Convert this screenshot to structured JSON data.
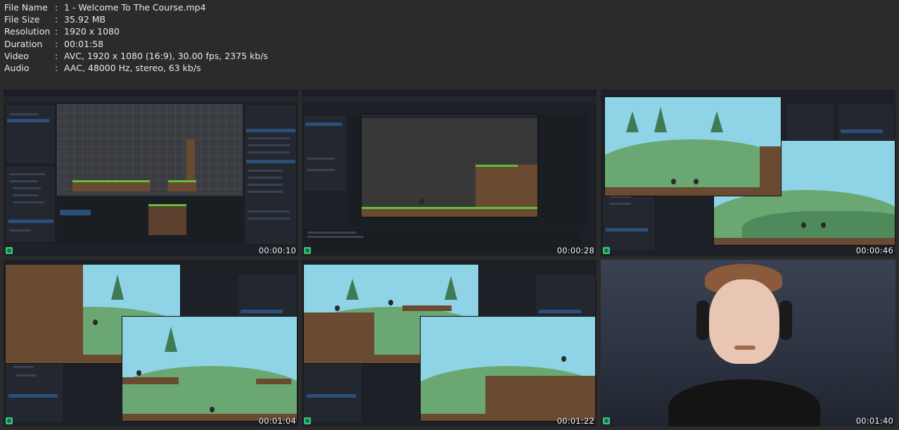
{
  "info": [
    {
      "key": "File Name",
      "value": "1 - Welcome To The Course.mp4"
    },
    {
      "key": "File Size",
      "value": "35.92 MB"
    },
    {
      "key": "Resolution",
      "value": "1920 x 1080"
    },
    {
      "key": "Duration",
      "value": "00:01:58"
    },
    {
      "key": "Video",
      "value": "AVC, 1920 x 1080 (16:9), 30.00 fps, 2375 kb/s"
    },
    {
      "key": "Audio",
      "value": "AAC, 48000 Hz, stereo, 63 kb/s"
    }
  ],
  "thumbnails": [
    {
      "timestamp": "00:00:10"
    },
    {
      "timestamp": "00:00:28"
    },
    {
      "timestamp": "00:00:46"
    },
    {
      "timestamp": "00:01:04"
    },
    {
      "timestamp": "00:01:22"
    },
    {
      "timestamp": "00:01:40"
    }
  ],
  "colors": {
    "background": "#2b2b2b",
    "editor": "#1d2127",
    "grass": "#5fbf3a",
    "dirt": "#6b4a32",
    "sky": "#8fd3e6"
  }
}
